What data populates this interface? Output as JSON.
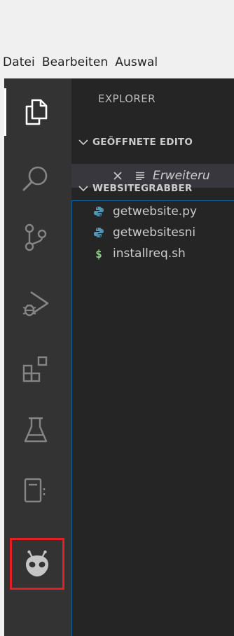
{
  "menubar": {
    "items": [
      "Datei",
      "Bearbeiten",
      "Auswal"
    ]
  },
  "activitybar": {
    "items": [
      {
        "name": "explorer-icon",
        "active": true
      },
      {
        "name": "search-icon",
        "active": false
      },
      {
        "name": "source-control-icon",
        "active": false
      },
      {
        "name": "run-debug-icon",
        "active": false
      },
      {
        "name": "extensions-icon",
        "active": false
      },
      {
        "name": "testing-flask-icon",
        "active": false
      },
      {
        "name": "notebook-icon",
        "active": false
      },
      {
        "name": "platformio-alien-icon",
        "active": false,
        "highlighted": true
      }
    ]
  },
  "sidebar": {
    "title": "EXPLORER",
    "open_editors": {
      "header": "GEÖFFNETE EDITO",
      "items": [
        {
          "label": "Erweiteru",
          "icon": "lines-icon"
        }
      ]
    },
    "folder": {
      "header": "WEBSITEGRABBER",
      "files": [
        {
          "name": "getwebsite.py",
          "icon": "python-icon"
        },
        {
          "name": "getwebsitesni",
          "icon": "python-icon"
        },
        {
          "name": "installreq.sh",
          "icon": "shell-dollar-icon"
        }
      ]
    }
  },
  "colors": {
    "activity_bg": "#333333",
    "sidebar_bg": "#252526",
    "selection_bg": "#37373d",
    "focus_border": "#0e639c",
    "highlight_box": "#e31e24",
    "shell_icon": "#89d185"
  }
}
